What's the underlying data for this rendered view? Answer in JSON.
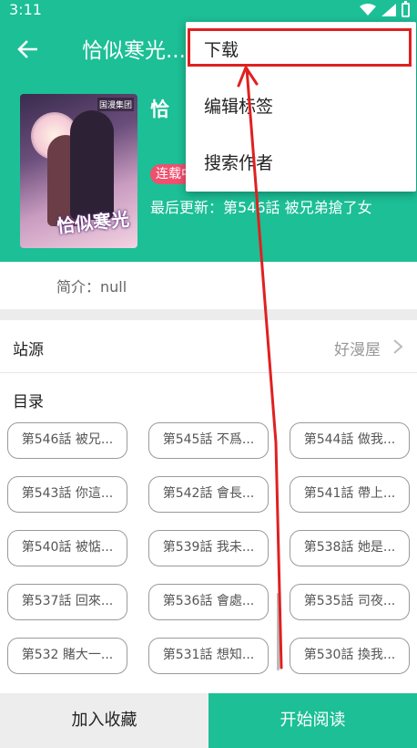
{
  "status_bar": {
    "time": "3:11"
  },
  "header": {
    "title": "恰似寒光..."
  },
  "comic": {
    "title": "恰",
    "status": "连载中",
    "last_update": "最后更新：第546話 被兄弟搶了女",
    "cover_publisher": "国漫集团",
    "cover_logo": "恰似寒光"
  },
  "intro": {
    "text": "简介：null"
  },
  "source": {
    "label": "站源",
    "value": "好漫屋"
  },
  "catalog": {
    "label": "目录",
    "chapters": [
      [
        "第546話 被兄...",
        "第545話 不爲...",
        "第544話 做我..."
      ],
      [
        "第543話 你這...",
        "第542話 會長...",
        "第541話 帶上..."
      ],
      [
        "第540話 被惦...",
        "第539話 我未...",
        "第538話 她是..."
      ],
      [
        "第537話 回來...",
        "第536話 會處...",
        "第535話 司夜..."
      ],
      [
        "第532 賭大一...",
        "第531話 想知...",
        "第530話 換我..."
      ]
    ]
  },
  "bottom": {
    "favorite": "加入收藏",
    "read": "开始阅读"
  },
  "menu": {
    "items": [
      "下载",
      "编辑标签",
      "搜索作者"
    ]
  },
  "colors": {
    "accent": "#1cbf96",
    "badge": "#f0506e",
    "annotation": "#e02020"
  }
}
